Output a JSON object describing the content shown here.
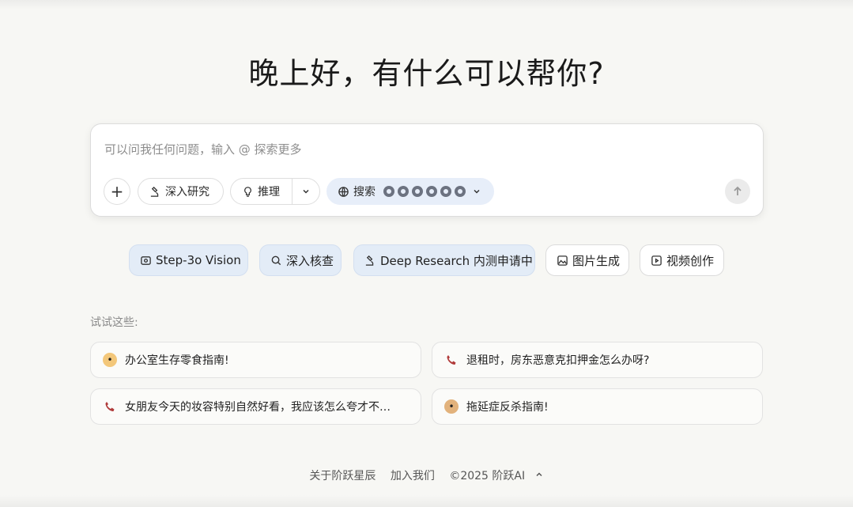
{
  "greeting": "晚上好，有什么可以帮你?",
  "composer": {
    "placeholder": "可以问我任何问题，输入 @ 探索更多",
    "research_label": "深入研究",
    "reason_label": "推理",
    "search_label": "搜索"
  },
  "chips": [
    {
      "label": "Step-3o Vision"
    },
    {
      "label": "深入核查"
    },
    {
      "label": "Deep Research 内测申请中"
    },
    {
      "label": "图片生成"
    },
    {
      "label": "视频创作"
    }
  ],
  "try_hint": "试试这些:",
  "suggestions": [
    {
      "text": "办公室生存零食指南!",
      "emoji": "food-face-icon",
      "color": "#e3a14f"
    },
    {
      "text": "退租时，房东恶意克扣押金怎么办呀?",
      "emoji": "phone-icon",
      "color": "#b03a3a"
    },
    {
      "text": "女朋友今天的妆容特别自然好看，我应该怎么夸才不…",
      "emoji": "phone-icon",
      "color": "#b03a3a"
    },
    {
      "text": "拖延症反杀指南!",
      "emoji": "cookie-face-icon",
      "color": "#c98a4a"
    }
  ],
  "footer": {
    "about": "关于阶跃星辰",
    "join": "加入我们",
    "copyright": "©2025 阶跃AI"
  },
  "colors": {
    "background": "#f7f7f4",
    "search_bg": "#e7eef9",
    "chip_tint": "#e3ecf7"
  }
}
